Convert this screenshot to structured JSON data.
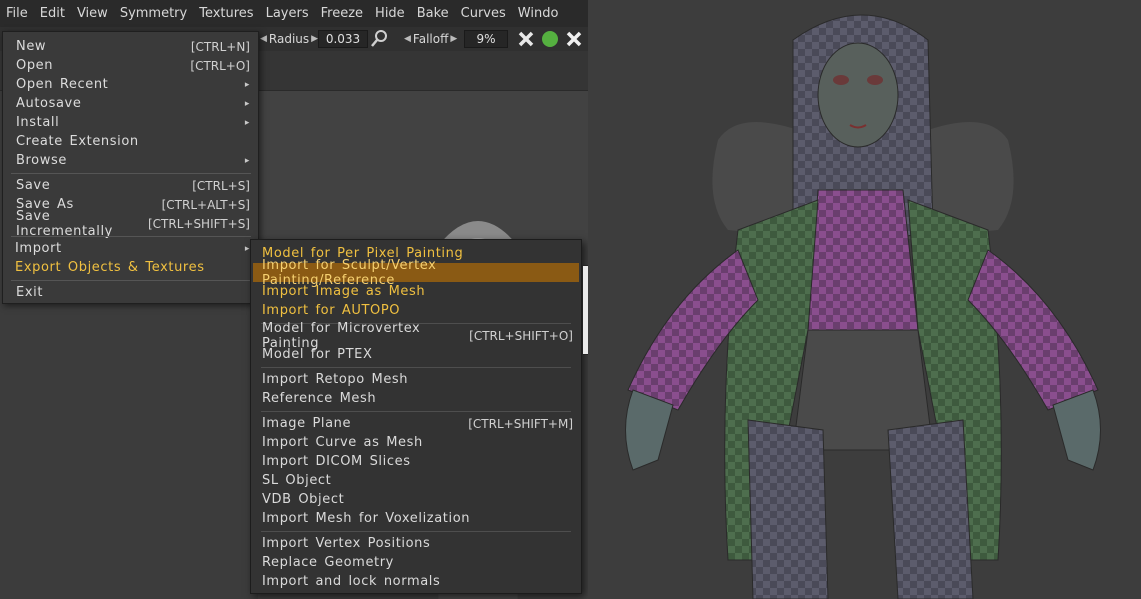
{
  "menubar": {
    "items": [
      "File",
      "Edit",
      "View",
      "Symmetry",
      "Textures",
      "Layers",
      "Freeze",
      "Hide",
      "Bake",
      "Curves",
      "Windo"
    ]
  },
  "toolbar": {
    "radius_label": "Radius",
    "radius_value": "0.033",
    "falloff_label": "Falloff",
    "falloff_value": "9%",
    "brush_icon": "brush-icon",
    "close_icon": "close-icon",
    "status_color": "#55b040"
  },
  "file_menu": {
    "items": [
      {
        "label": "New",
        "shortcut": "[CTRL+N]"
      },
      {
        "label": "Open",
        "shortcut": "[CTRL+O]"
      },
      {
        "label": "Open Recent",
        "submenu": "▸"
      },
      {
        "label": "Autosave",
        "submenu": "▸"
      },
      {
        "label": "Install",
        "submenu": "▸"
      },
      {
        "label": "Create Extension"
      },
      {
        "label": "Browse",
        "submenu": "▸"
      },
      {
        "label": "Save",
        "shortcut": "[CTRL+S]"
      },
      {
        "label": "Save As",
        "shortcut": "[CTRL+ALT+S]"
      },
      {
        "label": "Save Incrementally",
        "shortcut": "[CTRL+SHIFT+S]"
      },
      {
        "label": "Import",
        "submenu": "▸"
      },
      {
        "label": "Export Objects & Textures"
      },
      {
        "label": "Exit"
      }
    ]
  },
  "import_submenu": {
    "items": [
      {
        "label": "Model for Per Pixel Painting"
      },
      {
        "label": "Import for Sculpt/Vertex Painting/Reference"
      },
      {
        "label": "Import Image as Mesh"
      },
      {
        "label": "Import for AUTOPO"
      },
      {
        "label": "Model for Microvertex Painting",
        "shortcut": "[CTRL+SHIFT+O]"
      },
      {
        "label": "Model for PTEX"
      },
      {
        "label": "Import Retopo Mesh"
      },
      {
        "label": "Reference Mesh"
      },
      {
        "label": "Image Plane",
        "shortcut": "[CTRL+SHIFT+M]"
      },
      {
        "label": "Import Curve as Mesh"
      },
      {
        "label": "Import DICOM Slices"
      },
      {
        "label": "SL Object"
      },
      {
        "label": "VDB Object"
      },
      {
        "label": "Import Mesh for Voxelization"
      },
      {
        "label": "Import Vertex Positions"
      },
      {
        "label": "Replace Geometry"
      },
      {
        "label": "Import and lock normals"
      }
    ]
  },
  "colors": {
    "highlight": "#8a5a14",
    "accent_text": "#f0c040"
  }
}
